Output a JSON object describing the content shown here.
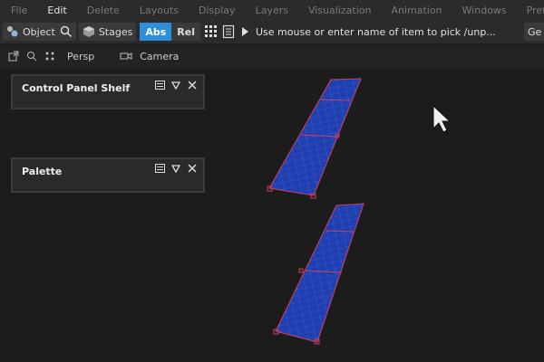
{
  "menu": {
    "items": [
      "File",
      "Edit",
      "Delete",
      "Layouts",
      "Display",
      "Layers",
      "Visualization",
      "Animation",
      "Windows",
      "Preferen"
    ]
  },
  "toolbar": {
    "object_label": "Object",
    "stages_label": "Stages",
    "abs_label": "Abs",
    "rel_label": "Rel",
    "prompt_text": "Use mouse or enter name of item to pick /unp...",
    "right_label": "Ge"
  },
  "viewbar": {
    "persp_label": "Persp",
    "camera_label": "Camera"
  },
  "panels": {
    "control_panel_shelf": {
      "title": "Control Panel Shelf"
    },
    "palette": {
      "title": "Palette"
    }
  },
  "colors": {
    "active_segment": "#2f8ed9",
    "panel_surface": "#1f3fb0",
    "panel_edge": "#d04060"
  }
}
